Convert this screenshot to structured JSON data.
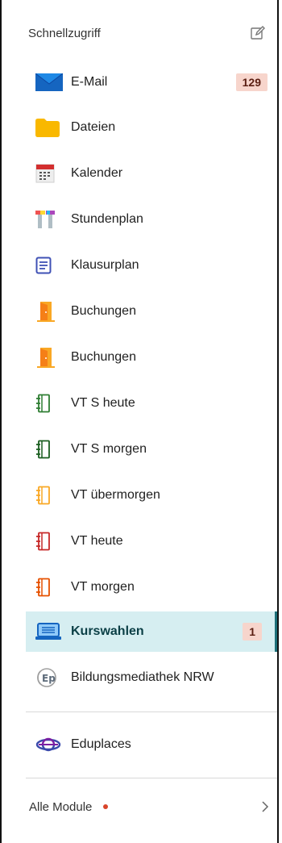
{
  "header": {
    "title": "Schnellzugriff"
  },
  "items": [
    {
      "label": "E-Mail",
      "badge": "129"
    },
    {
      "label": "Dateien"
    },
    {
      "label": "Kalender"
    },
    {
      "label": "Stundenplan"
    },
    {
      "label": "Klausurplan"
    },
    {
      "label": "Buchungen"
    },
    {
      "label": "Buchungen"
    },
    {
      "label": "VT S heute"
    },
    {
      "label": "VT S morgen"
    },
    {
      "label": "VT übermorgen"
    },
    {
      "label": "VT heute"
    },
    {
      "label": "VT morgen"
    },
    {
      "label": "Kurswahlen",
      "badge": "1"
    },
    {
      "label": "Bildungsmediathek NRW"
    }
  ],
  "extra": {
    "label": "Eduplaces"
  },
  "footer": {
    "label": "Alle Module"
  },
  "colors": {
    "accent": "#1d6f78",
    "active_bg": "#d6eef1",
    "badge_bg": "#f7d5cc",
    "notification_dot": "#d9452b"
  }
}
